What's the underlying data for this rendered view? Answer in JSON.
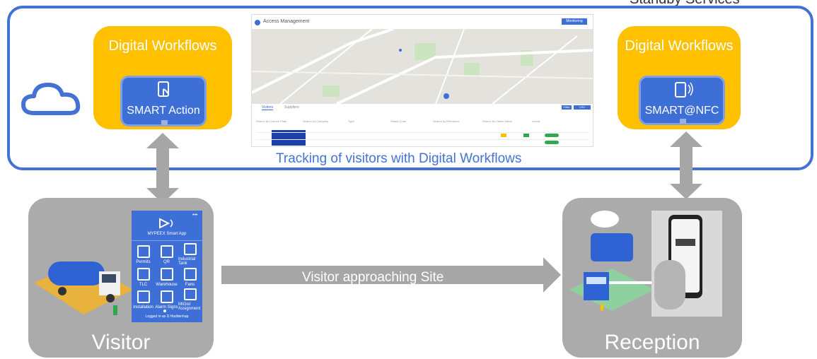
{
  "top_note": "Standby Services",
  "left_card": {
    "title": "Digital Workflows",
    "inner_label": "SMART Action"
  },
  "right_card": {
    "title": "Digital Workflows",
    "inner_label": "SMART@NFC"
  },
  "screenshot": {
    "title": "Access Management",
    "button_label": "Monitoring",
    "tabs": [
      "Visitors",
      "Suppliers"
    ],
    "actions": [
      "Filter",
      "CSV Download"
    ],
    "filters": [
      "Search by Licence Plate",
      "Search by Company",
      "Type",
      "Status Code",
      "Search by Reference",
      "Search by Visitor Name",
      "Arrival"
    ]
  },
  "caption": "Tracking of visitors with Digital Workflows",
  "arrow_label": "Visitor approaching Site",
  "visitor": {
    "label": "Visitor"
  },
  "reception": {
    "label": "Reception"
  },
  "app": {
    "title": "MYPEEX Smart App",
    "tiles": [
      "Permits",
      "QR",
      "Industrial Tank",
      "TLC",
      "Warehouse",
      "Fans",
      "Installation",
      "Alarm Signs",
      "MIGist Assignment"
    ],
    "footer": "Logged in as D.Haddenhap"
  },
  "colors": {
    "frame": "#4472d4",
    "card": "#ffc000",
    "inner": "#3d6fd6",
    "grey": "#ababab",
    "arrow": "#a6a6a6"
  }
}
